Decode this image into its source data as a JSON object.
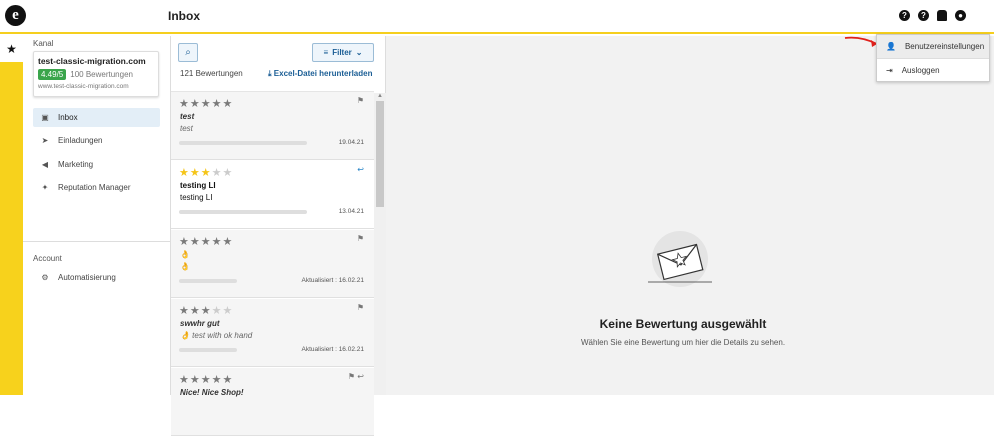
{
  "app": {
    "logo_glyph": "e",
    "page_title": "Inbox"
  },
  "topbar": {
    "icons": [
      "help-circle-icon",
      "question-icon",
      "bell-icon",
      "user-icon"
    ]
  },
  "rail": {
    "star_glyph": "★"
  },
  "sidebar": {
    "channel_label": "Kanal",
    "channel": {
      "name": "test-classic-migration.com",
      "rating": "4.49/5",
      "reviews_count": "100 Bewertungen",
      "url": "www.test-classic-migration.com"
    },
    "items": [
      {
        "label": "Inbox",
        "icon": "inbox-icon",
        "active": true
      },
      {
        "label": "Einladungen",
        "icon": "paper-plane-icon"
      },
      {
        "label": "Marketing",
        "icon": "megaphone-icon"
      },
      {
        "label": "Reputation Manager",
        "icon": "sparkle-icon"
      }
    ],
    "account_label": "Account",
    "account_items": [
      {
        "label": "Automatisierung",
        "icon": "gear-cycle-icon"
      }
    ]
  },
  "list": {
    "filter_label": "Filter",
    "count_text": "121 Bewertungen",
    "excel_label": "Excel-Datei herunterladen",
    "reviews": [
      {
        "stars": 5,
        "filled": 0,
        "title": "test",
        "text": "test",
        "date": "19.04.21",
        "flag": true,
        "reply": false
      },
      {
        "stars": 5,
        "filled": 3,
        "title": "testing LI",
        "text": "testing LI",
        "date": "13.04.21",
        "flag": false,
        "reply": true
      },
      {
        "stars": 5,
        "filled": 0,
        "title": "👌",
        "text": "👌",
        "date": "Aktualisiert : 16.02.21",
        "flag": true,
        "reply": false
      },
      {
        "stars": 5,
        "filled": 3,
        "title": "swwhr gut",
        "text": "👌 test with ok hand",
        "date": "Aktualisiert : 16.02.21",
        "flag": true,
        "reply": false
      },
      {
        "stars": 5,
        "filled": 0,
        "title": "Nice! Nice Shop!",
        "text": "",
        "date": "",
        "flag": true,
        "reply": true
      }
    ]
  },
  "detail": {
    "empty_title": "Keine Bewertung ausgewählt",
    "empty_subtitle": "Wählen Sie eine Bewertung um hier die Details zu sehen."
  },
  "dropdown": {
    "items": [
      {
        "label": "Benutzereinstellungen",
        "icon": "user-icon"
      },
      {
        "label": "Ausloggen",
        "icon": "logout-icon"
      }
    ]
  },
  "colors": {
    "accent_yellow": "#f7d21c",
    "link_blue": "#1b5e95",
    "rating_green": "#3aa54b",
    "arrow_red": "#e0201b"
  }
}
